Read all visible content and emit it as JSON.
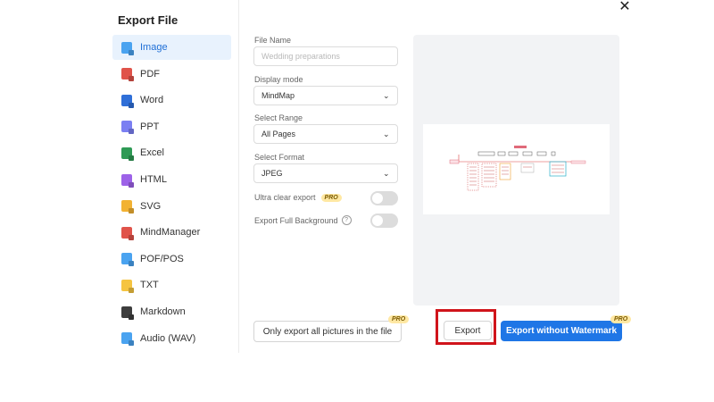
{
  "dialog": {
    "title": "Export File",
    "close_glyph": "✕"
  },
  "sidebar": {
    "items": [
      {
        "label": "Image",
        "icon": "image-icon",
        "color": "#4aa3f0",
        "active": true
      },
      {
        "label": "PDF",
        "icon": "pdf-icon",
        "color": "#e0534a",
        "active": false
      },
      {
        "label": "Word",
        "icon": "word-icon",
        "color": "#2f6fd8",
        "active": false
      },
      {
        "label": "PPT",
        "icon": "ppt-icon",
        "color": "#7b7ff2",
        "active": false
      },
      {
        "label": "Excel",
        "icon": "excel-icon",
        "color": "#2e9a55",
        "active": false
      },
      {
        "label": "HTML",
        "icon": "html-icon",
        "color": "#9d62e8",
        "active": false
      },
      {
        "label": "SVG",
        "icon": "svg-icon",
        "color": "#f2b233",
        "active": false
      },
      {
        "label": "MindManager",
        "icon": "mindmanager-icon",
        "color": "#e0534a",
        "active": false
      },
      {
        "label": "POF/POS",
        "icon": "pof-pos-icon",
        "color": "#4aa3f0",
        "active": false
      },
      {
        "label": "TXT",
        "icon": "txt-icon",
        "color": "#f5c441",
        "active": false
      },
      {
        "label": "Markdown",
        "icon": "markdown-icon",
        "color": "#3d3d3d",
        "active": false
      },
      {
        "label": "Audio (WAV)",
        "icon": "audio-icon",
        "color": "#4aa3f0",
        "active": false
      }
    ]
  },
  "form": {
    "file_name_label": "File Name",
    "file_name_placeholder": "Wedding preparations",
    "display_mode_label": "Display mode",
    "display_mode_value": "MindMap",
    "select_range_label": "Select Range",
    "select_range_value": "All Pages",
    "select_format_label": "Select Format",
    "select_format_value": "JPEG",
    "ultra_clear_label": "Ultra clear export",
    "export_bg_label": "Export Full Background",
    "pro_badge": "PRO",
    "help_glyph": "?",
    "chevron_glyph": "⌄"
  },
  "footer": {
    "pictures_button": "Only export all pictures in the file",
    "export_button": "Export",
    "no_watermark_button": "Export without Watermark",
    "pro_tag": "PRO"
  },
  "colors": {
    "accent": "#1f76e6",
    "highlight": "#d0141b",
    "active_bg": "#e8f2fd"
  }
}
